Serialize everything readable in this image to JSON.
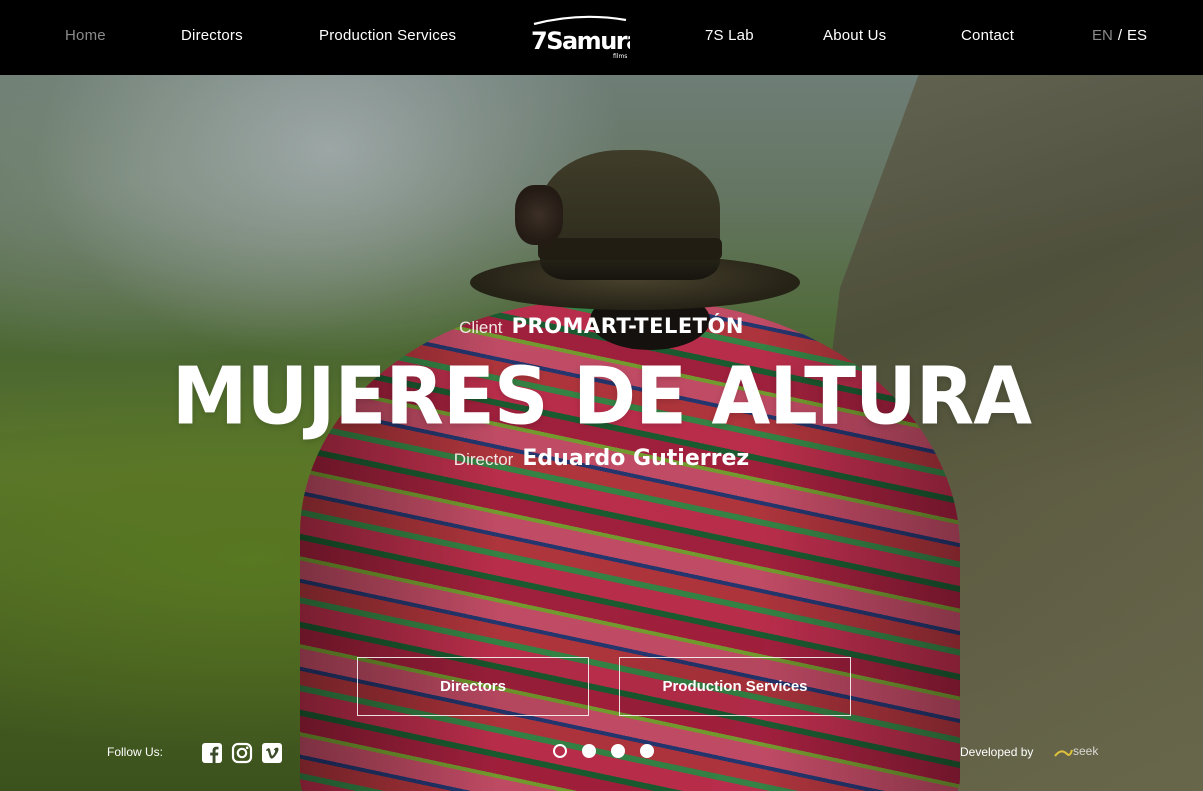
{
  "nav": {
    "items": [
      {
        "label": "Home",
        "active": true
      },
      {
        "label": "Directors"
      },
      {
        "label": "Production Services"
      },
      {
        "label": "7S Lab"
      },
      {
        "label": "About Us"
      },
      {
        "label": "Contact"
      }
    ],
    "logo": {
      "main": "7Samurai",
      "sub": "films"
    },
    "lang": {
      "current": "EN",
      "separator": "/",
      "other": "ES"
    }
  },
  "hero": {
    "client_label": "Client",
    "client_name": "PROMART-TELETÓN",
    "title": "MUJERES DE ALTURA",
    "director_label": "Director",
    "director_name": "Eduardo Gutierrez",
    "buttons": {
      "directors": "Directors",
      "services": "Production Services"
    }
  },
  "footer": {
    "follow_label": "Follow Us:",
    "social_icons": [
      "facebook-icon",
      "instagram-icon",
      "vimeo-icon"
    ],
    "slider": {
      "count": 4,
      "active_index": 0
    },
    "developed_by": "Developed by",
    "developer_logo": "seek"
  },
  "colors": {
    "nav_bg": "#000000",
    "nav_active": "#8a8a8a",
    "text": "#ffffff"
  }
}
